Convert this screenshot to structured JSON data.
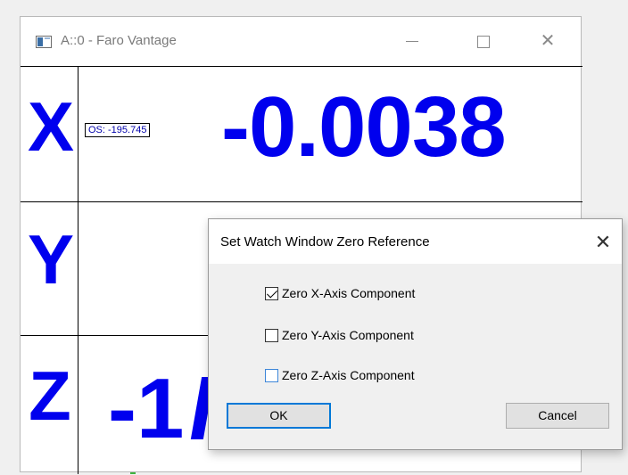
{
  "window": {
    "title": "A::0 - Faro Vantage",
    "minimize_icon": "minimize-icon",
    "maximize_icon": "maximize-icon",
    "close_glyph": "✕"
  },
  "watch": {
    "x_label": "X",
    "y_label": "Y",
    "z_label": "Z",
    "x_offset": "OS: -195.745",
    "x_value": "-0.0038",
    "z_value_partial": "-1"
  },
  "dialog": {
    "title": "Set Watch Window Zero Reference",
    "close_glyph": "✕",
    "options": [
      {
        "label": "Zero X-Axis Component",
        "checked": true
      },
      {
        "label": "Zero Y-Axis Component",
        "checked": false
      },
      {
        "label": "Zero Z-Axis Component",
        "checked": false
      }
    ],
    "ok_label": "OK",
    "cancel_label": "Cancel"
  },
  "colors": {
    "axis_blue": "#0000ee",
    "focus_blue": "#0078d7"
  }
}
